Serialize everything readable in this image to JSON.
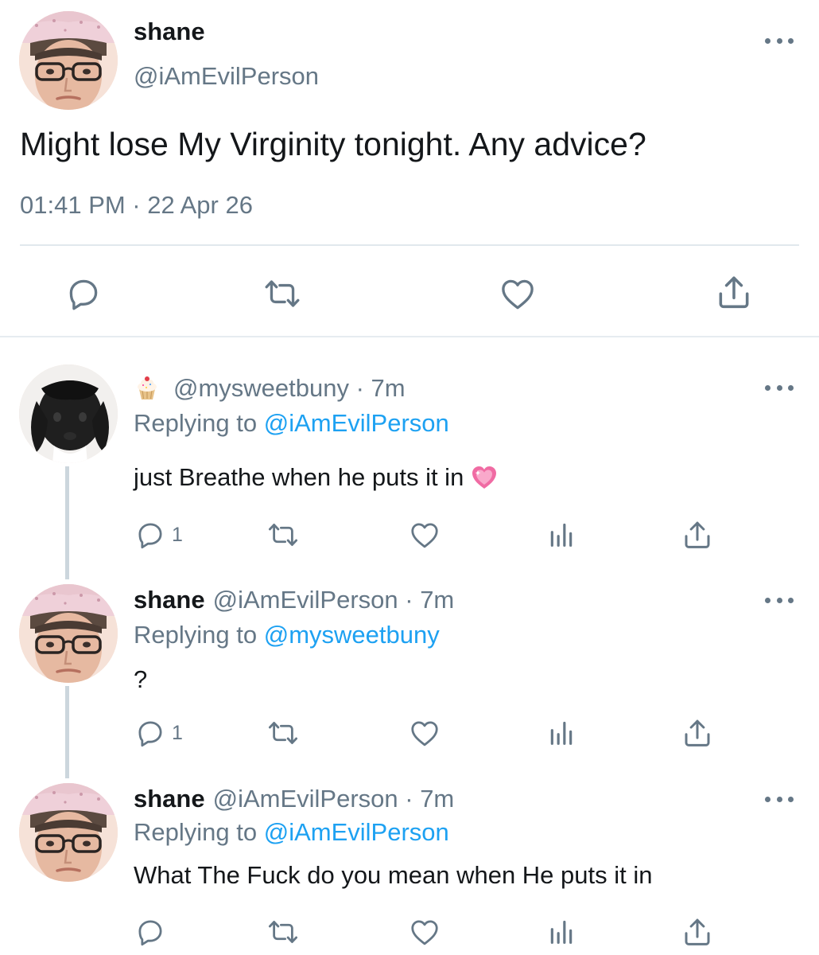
{
  "main_tweet": {
    "author_name": "shane",
    "author_handle": "@iAmEvilPerson",
    "text": "Might lose My Virginity tonight. Any advice?",
    "timestamp": "01:41 PM · 22 Apr 26",
    "avatar_icon": "profile-photo-icon"
  },
  "replies": [
    {
      "handle_line": "@mysweetbuny · 7m",
      "replying_prefix": "Replying to",
      "replying_to": "@iAmEvilPerson",
      "text": "just Breathe when he puts it in",
      "reply_count": "1",
      "avatar_icon": "bunny-photo-icon",
      "name_emoji_icon": "cupcake-icon",
      "text_emoji_icon": "sparkling-heart-icon"
    },
    {
      "author_name": "shane",
      "handle_line": "@iAmEvilPerson · 7m",
      "replying_prefix": "Replying to",
      "replying_to": "@mysweetbuny",
      "text": "?",
      "reply_count": "1",
      "avatar_icon": "profile-photo-icon"
    },
    {
      "author_name": "shane",
      "handle_line": "@iAmEvilPerson · 7m",
      "replying_prefix": "Replying to",
      "replying_to": "@iAmEvilPerson",
      "text": "What The Fuck do you mean when He puts it in",
      "avatar_icon": "profile-photo-icon"
    }
  ],
  "colors": {
    "text_primary": "#14171a",
    "text_secondary": "#657786",
    "link": "#1da1f2",
    "divider": "#e1e8ed",
    "thread_line": "#ccd6dd"
  }
}
